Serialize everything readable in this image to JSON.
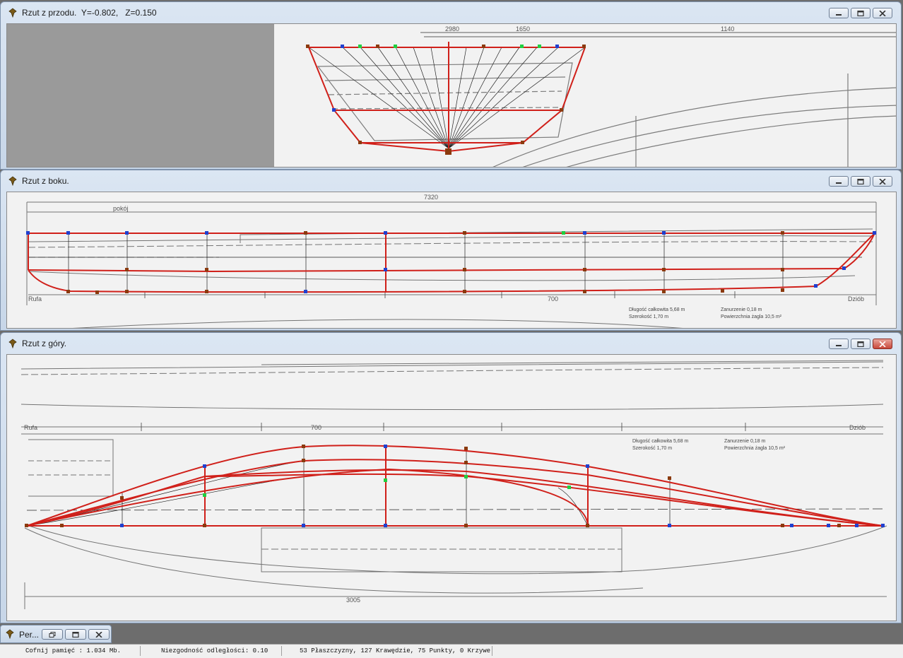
{
  "windows": {
    "front": {
      "title": "Rzut z przodu.  Y=-0.802,   Z=0.150"
    },
    "side": {
      "title": "Rzut z boku."
    },
    "top": {
      "title": "Rzut z góry."
    }
  },
  "taskbar": {
    "minimized_window": "Per..."
  },
  "status": {
    "memory": "Cofnij pamięć : 1.034 Mb.",
    "distance": "Niezgodność odległości: 0.10",
    "counts": "53 Płaszczyzny, 127 Krawędzie, 75 Punkty, 0 Krzywe"
  },
  "drawing": {
    "labels": [
      "2980",
      "1650",
      "1140",
      "7320",
      "pokój",
      "Rufa",
      "Dziób",
      "700",
      "3005"
    ],
    "legend": [
      "Długość całkowita  5,68 m",
      "Szerokość  1,70 m",
      "Zanurzenie  0,18 m",
      "Powierzchnia żagla  10,5 m²"
    ]
  },
  "icons": {
    "window": "pin-icon",
    "minimize": "minimize-icon",
    "maximize": "maximize-icon",
    "close": "close-icon",
    "restore": "restore-icon"
  },
  "colors": {
    "curve": "#d0201a",
    "point_blue": "#2040d0",
    "point_green": "#20d040",
    "point_brown": "#8b3a0e",
    "scan_bg": "#f2f2f2"
  }
}
